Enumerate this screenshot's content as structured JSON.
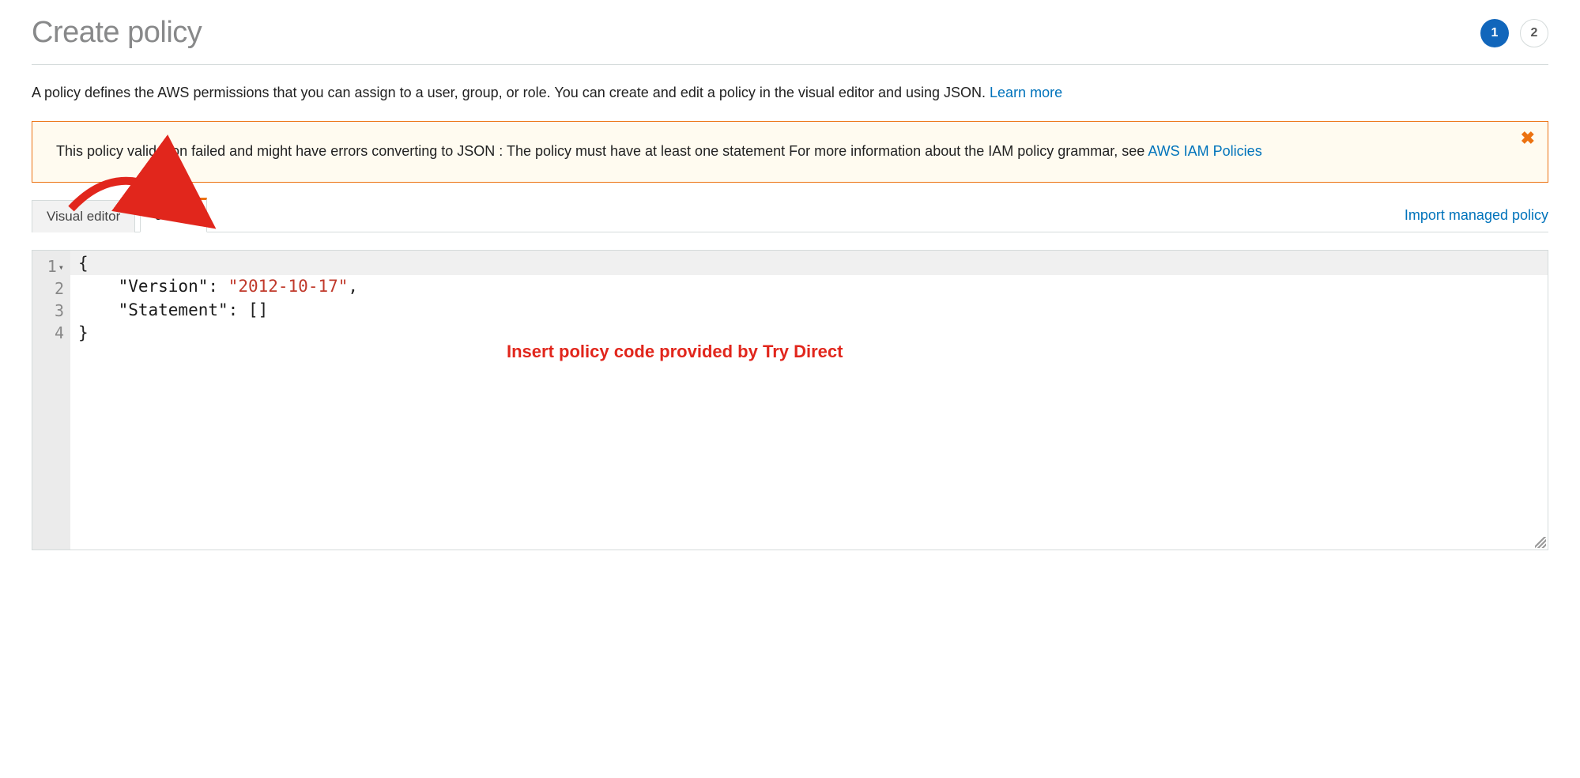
{
  "header": {
    "title": "Create policy",
    "steps": [
      "1",
      "2"
    ],
    "active_step_index": 0
  },
  "description": {
    "text": "A policy defines the AWS permissions that you can assign to a user, group, or role. You can create and edit a policy in the visual editor and using JSON. ",
    "link_text": "Learn more"
  },
  "alert": {
    "message_prefix": "This policy validation failed and might have errors converting to JSON : The policy must have at least one statement For more information about the IAM policy grammar, see ",
    "link_text": "AWS IAM Policies",
    "close_glyph": "✖"
  },
  "tabs": {
    "items": [
      "Visual editor",
      "JSON"
    ],
    "active_index": 1,
    "import_label": "Import managed policy"
  },
  "editor": {
    "line_numbers": [
      "1",
      "2",
      "3",
      "4"
    ],
    "code": {
      "l1": "{",
      "l2": "    \"Version\": \"2012-10-17\",",
      "l3": "    \"Statement\": []",
      "l4": "}"
    },
    "tokens": {
      "version_key": "\"Version\"",
      "version_val": "\"2012-10-17\"",
      "statement_key": "\"Statement\""
    }
  },
  "annotation": {
    "text": "Insert policy code provided by Try Direct",
    "arrow_color": "#e1261c"
  }
}
